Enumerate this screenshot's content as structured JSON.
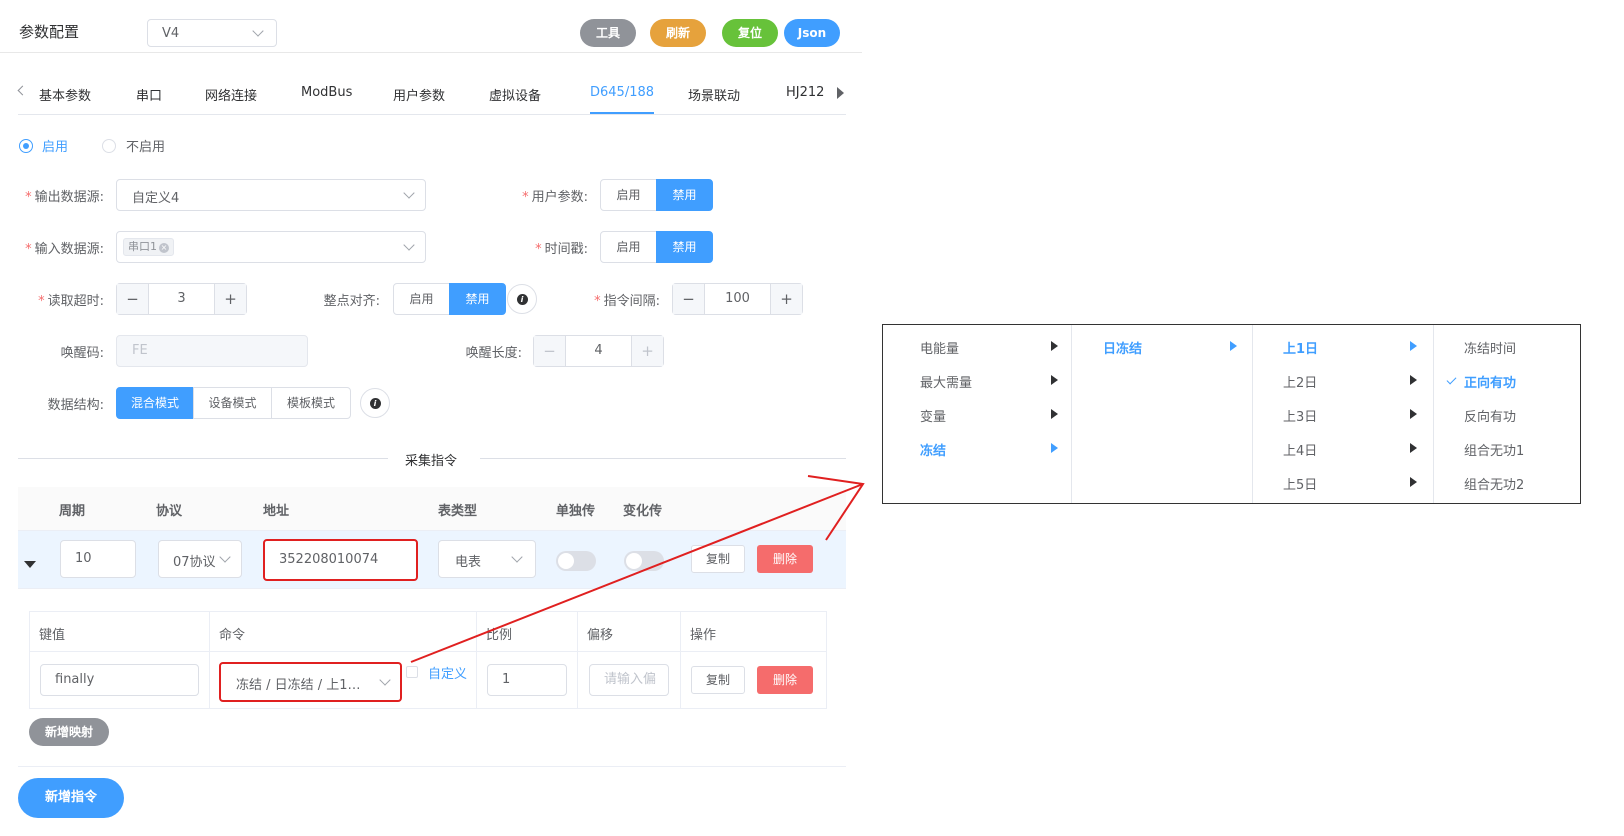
{
  "header": {
    "title": "参数配置",
    "version_select": "V4",
    "buttons": {
      "tools": "工具",
      "refresh": "刷新",
      "reset": "复位",
      "json": "Json"
    }
  },
  "tabs": [
    "基本参数",
    "串口",
    "网络连接",
    "ModBus",
    "用户参数",
    "虚拟设备",
    "D645/188",
    "场景联动",
    "HJ212"
  ],
  "active_tab": "D645/188",
  "enable": {
    "on_label": "启用",
    "off_label": "不启用",
    "selected": "启用"
  },
  "form": {
    "output_source": {
      "label": "输出数据源:",
      "value": "自定义4"
    },
    "user_params": {
      "label": "用户参数:",
      "options": [
        "启用",
        "禁用"
      ],
      "selected": "禁用"
    },
    "input_source": {
      "label": "输入数据源:",
      "tag": "串口1"
    },
    "timestamp": {
      "label": "时间戳:",
      "options": [
        "启用",
        "禁用"
      ],
      "selected": "禁用"
    },
    "read_timeout": {
      "label": "读取超时:",
      "value": "3"
    },
    "hour_align": {
      "label": "整点对齐:",
      "options": [
        "启用",
        "禁用"
      ],
      "selected": "禁用"
    },
    "cmd_interval": {
      "label": "指令间隔:",
      "value": "100"
    },
    "wake_code": {
      "label": "唤醒码:",
      "placeholder": "FE"
    },
    "wake_length": {
      "label": "唤醒长度:",
      "value": "4"
    },
    "data_struct": {
      "label": "数据结构:",
      "options": [
        "混合模式",
        "设备模式",
        "模板模式"
      ],
      "selected": "混合模式"
    }
  },
  "section_title": "采集指令",
  "command_table": {
    "headers": [
      "周期",
      "协议",
      "地址",
      "表类型",
      "单独传",
      "变化传"
    ],
    "row": {
      "period": "10",
      "protocol": "07协议",
      "address": "352208010074",
      "meter_type": "电表",
      "copy": "复制",
      "delete": "删除"
    }
  },
  "mapping_table": {
    "headers": [
      "键值",
      "命令",
      "比例",
      "偏移",
      "操作"
    ],
    "row": {
      "key": "finally",
      "command": "冻结 / 日冻结 / 上1…",
      "custom_label": "自定义",
      "ratio": "1",
      "offset_placeholder": "请输入偏",
      "copy": "复制",
      "delete": "删除"
    },
    "add_mapping": "新增映射"
  },
  "add_command": "新增指令",
  "cascader": {
    "col1": [
      "电能量",
      "最大需量",
      "变量",
      "冻结"
    ],
    "col1_active": "冻结",
    "col2": [
      "日冻结"
    ],
    "col2_active": "日冻结",
    "col3": [
      "上1日",
      "上2日",
      "上3日",
      "上4日",
      "上5日"
    ],
    "col3_active": "上1日",
    "col4": [
      "冻结时间",
      "正向有功",
      "反向有功",
      "组合无功1",
      "组合无功2"
    ],
    "col4_active": "正向有功"
  },
  "colors": {
    "primary": "#409eff",
    "danger": "#f56c6c",
    "tools": "#909399",
    "refresh": "#e6a23c",
    "reset": "#67c23a",
    "annotation": "#e02020"
  }
}
